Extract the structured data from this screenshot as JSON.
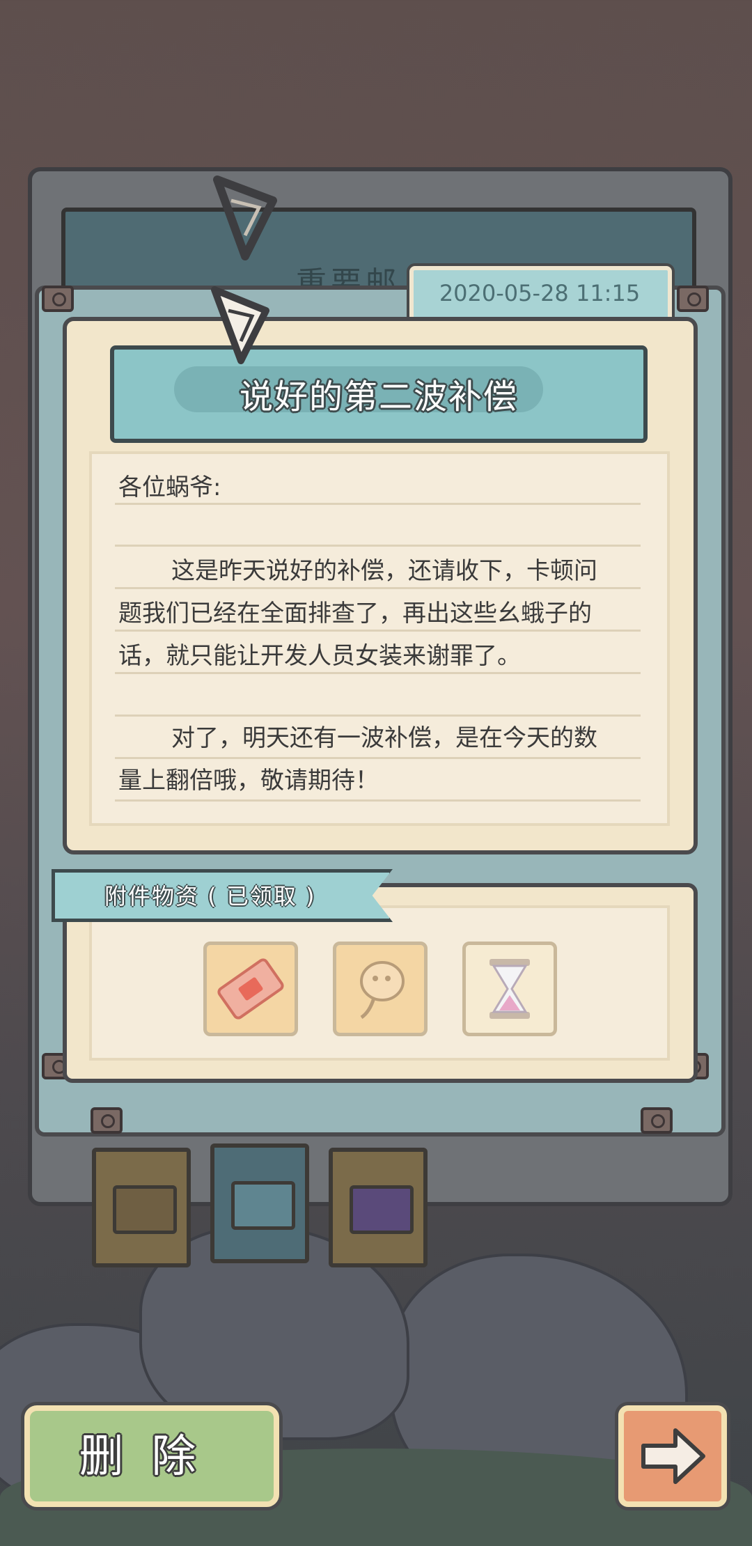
{
  "mail": {
    "back_title": "重要邮",
    "date": "2020-05-28  11:15",
    "title": "说好的第二波补偿",
    "greeting": "各位蜗爷:",
    "para1_line1": "这是昨天说好的补偿，还请收下，卡顿问",
    "para1_line2": "题我们已经在全面排查了，再出这些幺蛾子的",
    "para1_line3": "话，就只能让开发人员女装来谢罪了。",
    "para2_line1": "对了，明天还有一波补偿，是在今天的数",
    "para2_line2": "量上翻倍哦，敬请期待！"
  },
  "attachments": {
    "label": "附件物资 ( 已领取 )",
    "items": [
      {
        "icon": "ticket-icon"
      },
      {
        "icon": "tadpole-icon"
      },
      {
        "icon": "hourglass-icon"
      }
    ]
  },
  "tabs": [
    {
      "icon": "envelope-icon",
      "active": false
    },
    {
      "icon": "snail-mail-icon",
      "active": true
    },
    {
      "icon": "sign-icon",
      "active": false
    }
  ],
  "buttons": {
    "delete_label": "删除",
    "next_icon": "arrow-right-icon"
  },
  "colors": {
    "accent_teal": "#8cc5c7",
    "paper": "#f2e6cb",
    "delete_green": "#a8c88a",
    "next_orange": "#e79a73"
  }
}
